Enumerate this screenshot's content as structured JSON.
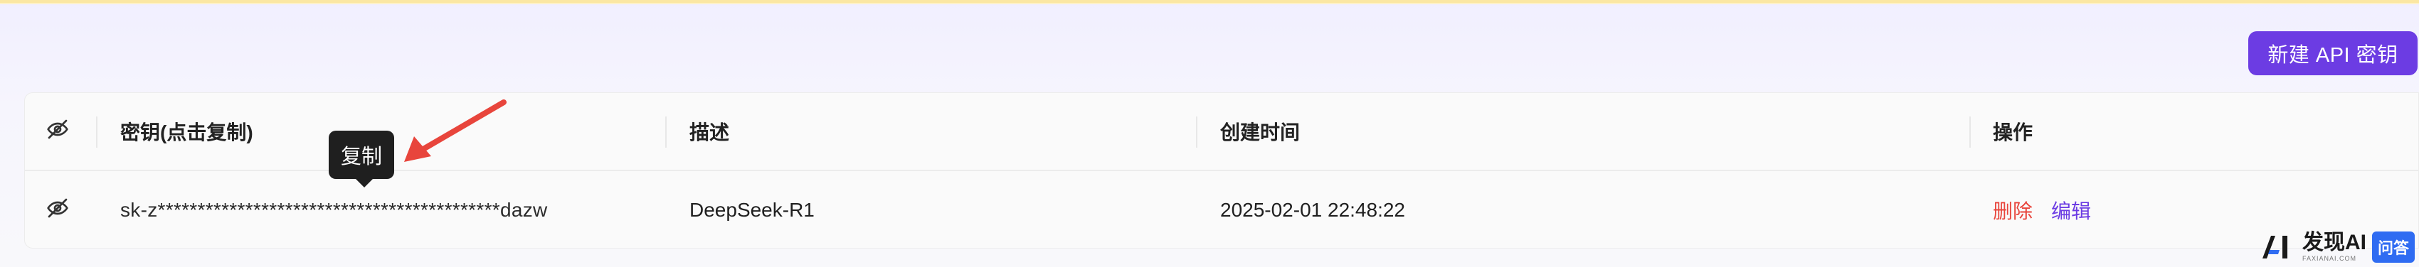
{
  "header": {
    "new_key_button": "新建 API 密钥"
  },
  "table": {
    "columns": [
      "密钥(点击复制)",
      "描述",
      "创建时间",
      "操作"
    ],
    "rows": [
      {
        "key": "sk-z*******************************************dazw",
        "description": "DeepSeek-R1",
        "created_at": "2025-02-01 22:48:22",
        "actions": [
          "删除",
          "编辑"
        ]
      }
    ]
  },
  "tooltip": {
    "text": "复制"
  },
  "icons": {
    "visibility": "eye-off-icon",
    "annotation": "red-arrow-icon"
  },
  "colors": {
    "accent": "#6c3ce3",
    "danger": "#e8453c",
    "tooltip_bg": "#1f1f1f",
    "annotation": "#e8453c"
  },
  "watermark": {
    "brand": "发现AI",
    "sub": "FAXIANAI.COM",
    "tag": "问答"
  }
}
